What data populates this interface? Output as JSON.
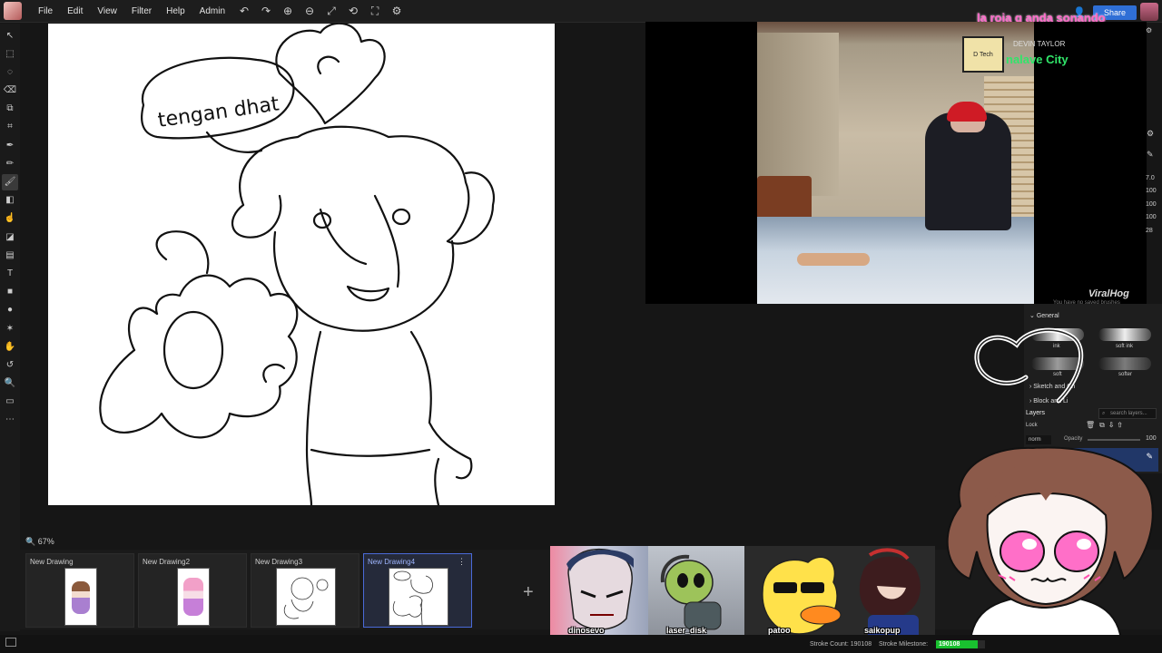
{
  "menu": {
    "items": [
      "File",
      "Edit",
      "View",
      "Filter",
      "Help",
      "Admin"
    ],
    "tool_icons": [
      "undo-icon",
      "redo-icon",
      "zoom-in-icon",
      "zoom-out-icon",
      "fit-icon",
      "rotate-icon",
      "fullscreen-icon",
      "settings-icon"
    ]
  },
  "overlay": {
    "stream_title": "la roia q anda sonando",
    "share_label": "Share"
  },
  "left_toolbar": [
    "select-arrow-icon",
    "marquee-icon",
    "lasso-icon",
    "eraser-select-icon",
    "transform-icon",
    "crop-icon",
    "pen-icon",
    "pencil-icon",
    "brush-icon",
    "eraser-icon",
    "smudge-icon",
    "fill-icon",
    "gradient-icon",
    "text-icon",
    "rect-icon",
    "ellipse-icon",
    "shape-icon",
    "pan-icon",
    "rotate-view-icon",
    "zoom-icon",
    "comment-icon",
    "more-icon"
  ],
  "canvas": {
    "speech_text": "tengan dhat"
  },
  "zoom_label": "67%",
  "drawings": [
    {
      "label": "New Drawing"
    },
    {
      "label": "New Drawing2"
    },
    {
      "label": "New Drawing3"
    },
    {
      "label": "New Drawing4"
    }
  ],
  "video": {
    "channel_logo_text": "D Tech",
    "channel_name": "DEVIN TAYLOR",
    "channel_city": "nalave City",
    "watermark": "ViralHog"
  },
  "right_panel": {
    "numbers": [
      "7.0",
      "100",
      "100",
      "100",
      "28"
    ],
    "no_brushes_text": "You have no saved brushes",
    "general_header": "General",
    "brushes": [
      "ink",
      "soft ink",
      "soft",
      "softer"
    ],
    "sketch_header": "Sketch and Ch",
    "block_header": "Block and Li",
    "layers_title": "Layers",
    "search_placeholder": "search layers...",
    "lock_label": "Lock",
    "blend_mode": "norm",
    "opacity_label": "Opacity",
    "opacity_value": "100"
  },
  "team": [
    "dinosevo",
    "laser_disk",
    "patoo",
    "saikopup"
  ],
  "status": {
    "stroke_count": "Stroke Count: 190108",
    "stroke_milestone": "Stroke Milestone:",
    "milestone_value": "190108",
    "milestone_progress": 0.85
  },
  "colors": {
    "accent_blue": "#2f6fd6",
    "active_tab": "#4a6ad8",
    "title_pink": "#ff69c8",
    "milestone_green": "#19c12f"
  }
}
